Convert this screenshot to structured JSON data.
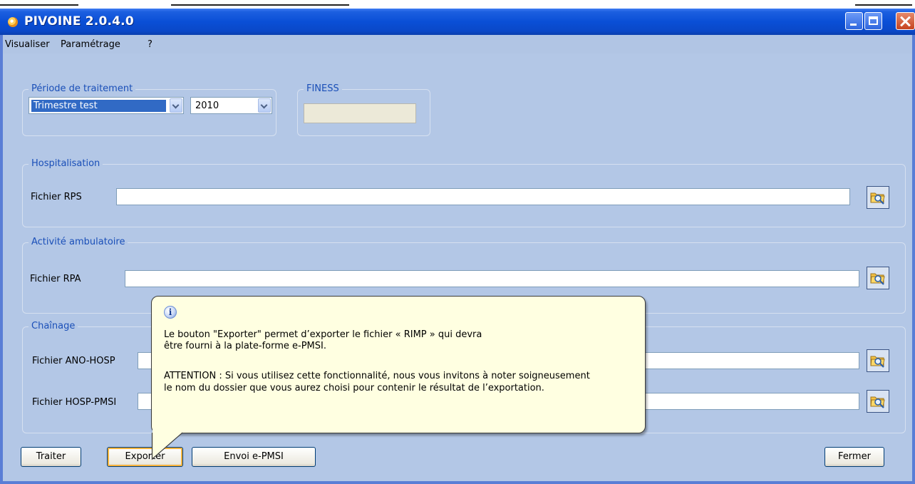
{
  "window": {
    "title": "PIVOINE 2.0.4.0"
  },
  "menu": [
    "Visualiser",
    "Paramétrage",
    "?"
  ],
  "periode": {
    "legend": "Période de traitement",
    "trimestre": "Trimestre test",
    "annee": "2010"
  },
  "finess": {
    "legend": "FINESS",
    "value": ""
  },
  "hospitalisation": {
    "legend": "Hospitalisation",
    "rps_label": "Fichier RPS"
  },
  "ambulatoire": {
    "legend": "Activité ambulatoire",
    "rpa_label": "Fichier RPA"
  },
  "chainage": {
    "legend": "Chaînage",
    "ano_label": "Fichier ANO-HOSP",
    "hosp_pmsi_label": "Fichier HOSP-PMSI"
  },
  "buttons": {
    "traiter": "Traiter",
    "exporter": "Exporter",
    "envoi": "Envoi e-PMSI",
    "fermer": "Fermer"
  },
  "tooltip": {
    "line1": "Le bouton \"Exporter\"  permet d’exporter le fichier « RIMP » qui devra",
    "line2": "être fourni à la plate-forme e-PMSI.",
    "line3": "ATTENTION : Si vous utilisez cette fonctionnalité, nous vous invitons à noter soigneusement",
    "line4": "le nom du dossier que vous aurez choisi pour contenir le résultat de l’exportation."
  },
  "icons": {
    "app": "pivoine-app-icon",
    "browse": "folder-search-icon",
    "info": "info-icon"
  },
  "colors": {
    "titlebar": "#0a4fd6",
    "client_bg": "#b3c7e6",
    "legend_text": "#1a4fb8",
    "tooltip_bg": "#ffffe1",
    "selection": "#316ac5"
  }
}
